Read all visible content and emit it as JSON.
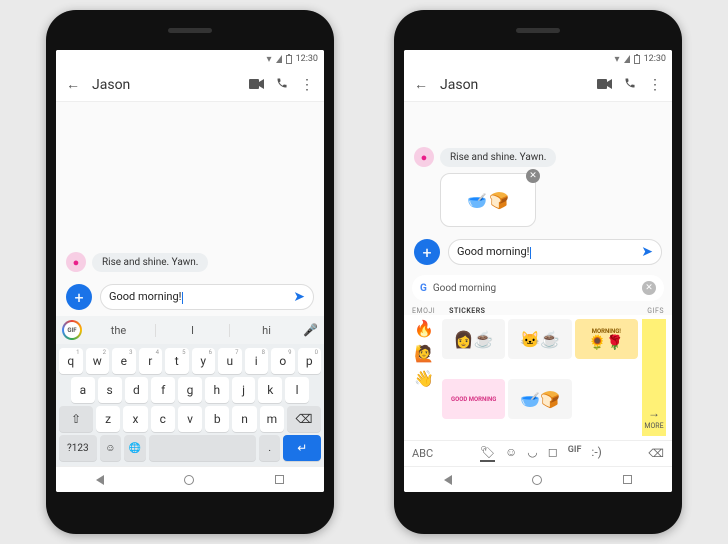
{
  "status": {
    "time": "12:30"
  },
  "header": {
    "back": "←",
    "title": "Jason",
    "video": "■",
    "call": "📞",
    "more": "⋮"
  },
  "chat": {
    "incoming": "Rise and shine. Yawn.",
    "compose_text": "Good morning!",
    "plus": "+",
    "send": "➤"
  },
  "gboard_left": {
    "gif_label": "GIF",
    "suggestions": [
      "the",
      "I",
      "hi"
    ],
    "row1": [
      {
        "k": "q",
        "n": "1"
      },
      {
        "k": "w",
        "n": "2"
      },
      {
        "k": "e",
        "n": "3"
      },
      {
        "k": "r",
        "n": "4"
      },
      {
        "k": "t",
        "n": "5"
      },
      {
        "k": "y",
        "n": "6"
      },
      {
        "k": "u",
        "n": "7"
      },
      {
        "k": "i",
        "n": "8"
      },
      {
        "k": "o",
        "n": "9"
      },
      {
        "k": "p",
        "n": "0"
      }
    ],
    "row2": [
      "a",
      "s",
      "d",
      "f",
      "g",
      "h",
      "j",
      "k",
      "l"
    ],
    "row3": [
      "z",
      "x",
      "c",
      "v",
      "b",
      "n",
      "m"
    ],
    "shift": "⇧",
    "backspace": "⌫",
    "numkey": "?123",
    "emoji": "☺",
    "globe": "🌐",
    "period": ".",
    "enter": "↵"
  },
  "gboard_right": {
    "search_text": "Good morning",
    "tabs": {
      "emoji": "EMOJI",
      "stickers": "STICKERS",
      "gifs": "GIFS"
    },
    "emoji_col": [
      "🔥",
      "🙋",
      "👋"
    ],
    "more": "MORE",
    "more_arrow": "→",
    "abc": "ABC",
    "gif": "GIF",
    "smile": ":-)",
    "del": "⌫",
    "morning_label": "MORNING!",
    "goodmorning_label": "GOOD MORNING"
  },
  "nav": {
    "back": "◁",
    "home": "○",
    "recent": "□"
  }
}
